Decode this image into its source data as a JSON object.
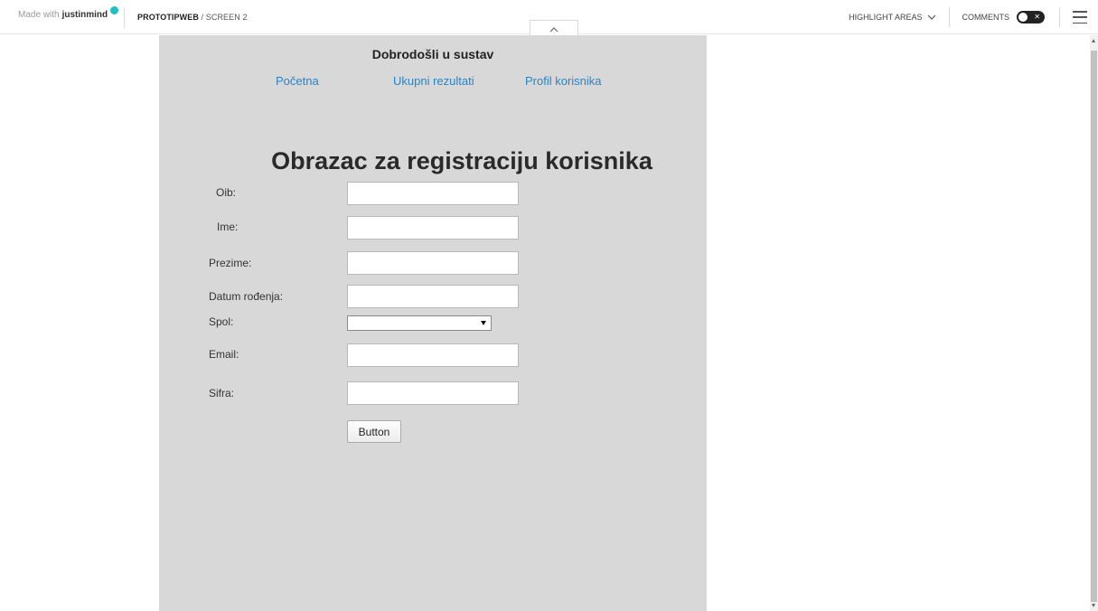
{
  "topbar": {
    "made_with": "Made with",
    "brand": "justinmind",
    "project": "PROTOTIPWEB",
    "separator": " / ",
    "screen": "SCREEN 2",
    "highlight_areas": "HIGHLIGHT AREAS",
    "comments": "COMMENTS",
    "comments_toggle_state": "off"
  },
  "page": {
    "welcome": "Dobrodošli u sustav",
    "nav": [
      {
        "label": "Početna"
      },
      {
        "label": "Ukupni rezultati"
      },
      {
        "label": "Profil korisnika"
      }
    ],
    "form_title": "Obrazac za registraciju korisnika",
    "fields": {
      "oib": {
        "label": "Oib:",
        "value": ""
      },
      "ime": {
        "label": "Ime:",
        "value": ""
      },
      "prezime": {
        "label": "Prezime:",
        "value": ""
      },
      "datum": {
        "label": "Datum rođenja:",
        "value": ""
      },
      "spol": {
        "label": "Spol:",
        "value": ""
      },
      "email": {
        "label": "Email:",
        "value": ""
      },
      "sifra": {
        "label": "Sifra:",
        "value": ""
      }
    },
    "submit_label": "Button"
  },
  "colors": {
    "canvas_bg": "#d8d8d8",
    "link": "#2a84c6",
    "brand_accent": "#20c0c8"
  }
}
